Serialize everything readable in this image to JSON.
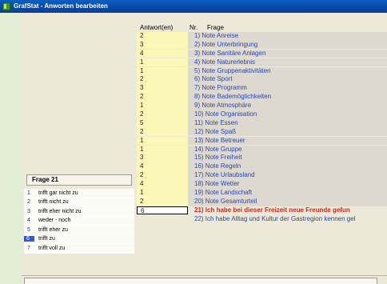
{
  "window": {
    "title": "GrafStat - Anworten bearbeiten"
  },
  "grid": {
    "headers": {
      "answers": "Antwort(en)",
      "nr": "Nr.",
      "frage": "Frage"
    },
    "rows": [
      {
        "answer": "2",
        "question": "1) Note Anreise"
      },
      {
        "answer": "3",
        "question": "2) Note Unterbringung"
      },
      {
        "answer": "4",
        "question": "3) Note Sanitäre Anlagen"
      },
      {
        "answer": "1",
        "question": "4) Note Naturerlebnis"
      },
      {
        "answer": "1",
        "question": "5) Note Gruppenaktivitäten"
      },
      {
        "answer": "2",
        "question": "6) Note Sport"
      },
      {
        "answer": "3",
        "question": "7) Note Programm"
      },
      {
        "answer": "2",
        "question": "8) Note Bademöglichkeiten"
      },
      {
        "answer": "1",
        "question": "9) Note Atmosphäre"
      },
      {
        "answer": "2",
        "question": "10) Note Organisation"
      },
      {
        "answer": "5",
        "question": "11) Note Essen"
      },
      {
        "answer": "2",
        "question": "12) Note Spaß"
      },
      {
        "answer": "1",
        "question": "13) Note Betreuer"
      },
      {
        "answer": "1",
        "question": "14) Note Gruppe"
      },
      {
        "answer": "3",
        "question": "15) Note Freiheit"
      },
      {
        "answer": "4",
        "question": "16) Note Regeln"
      },
      {
        "answer": "2",
        "question": "17) Note Urlaubsland"
      },
      {
        "answer": "4",
        "question": "18) Note Wetter"
      },
      {
        "answer": "1",
        "question": "19) Note Landschaft"
      },
      {
        "answer": "2",
        "question": "20) Note Gesamturteil"
      }
    ],
    "current": {
      "answer": "6",
      "question": "21) Ich habe bei dieser Freizeit neue Freunde gefun"
    },
    "next": {
      "answer": "",
      "question": "22) Ich habe Alltag und Kultur der Gastregion kennen gel"
    }
  },
  "left": {
    "frage_label": "Frage 21",
    "answers": [
      {
        "n": "1",
        "t": "trifft gar nicht zu"
      },
      {
        "n": "2",
        "t": "trifft nicht zu"
      },
      {
        "n": "3",
        "t": "trifft eher nicht zu"
      },
      {
        "n": "4",
        "t": "weder - noch"
      },
      {
        "n": "5",
        "t": "trifft eher zu"
      },
      {
        "n": "6",
        "t": "trifft zu"
      },
      {
        "n": "7",
        "t": "trifft voll zu"
      }
    ],
    "selected": "6"
  }
}
